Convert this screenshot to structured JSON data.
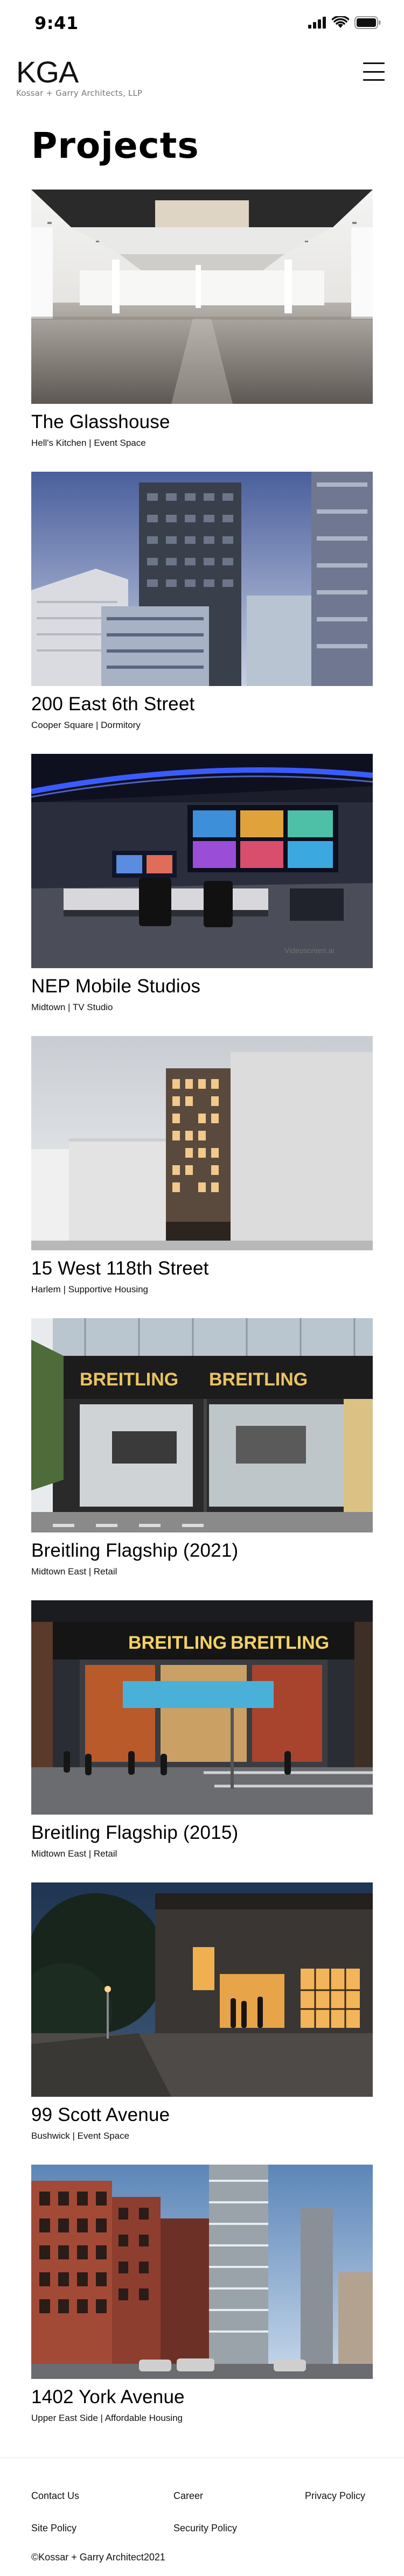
{
  "status_bar": {
    "time": "9:41",
    "icons": [
      "signal-icon",
      "wifi-icon",
      "battery-icon"
    ]
  },
  "header": {
    "logo_mark": "KGA",
    "logo_sub": "Kossar + Garry Architects, LLP",
    "menu_icon": "hamburger-menu-icon"
  },
  "page": {
    "title": "Projects"
  },
  "projects": [
    {
      "name": "The Glasshouse",
      "meta": "Hell's Kitchen | Event Space"
    },
    {
      "name": "200 East 6th Street",
      "meta": "Cooper Square | Dormitory"
    },
    {
      "name": "NEP Mobile Studios",
      "meta": "Midtown | TV Studio"
    },
    {
      "name": "15 West 118th Street",
      "meta": "Harlem | Supportive Housing"
    },
    {
      "name": "Breitling Flagship (2021)",
      "meta": "Midtown East | Retail"
    },
    {
      "name": "Breitling Flagship (2015)",
      "meta": "Midtown East | Retail"
    },
    {
      "name": "99 Scott Avenue",
      "meta": "Bushwick | Event Space"
    },
    {
      "name": "1402 York Avenue",
      "meta": "Upper East Side | Affordable Housing"
    }
  ],
  "images": {
    "breitling_sign": "BREITLING",
    "nep_watermark": "Videoscreen.ai"
  },
  "footer": {
    "contact": "Contact Us",
    "career": "Career",
    "privacy": "Privacy Policy",
    "site": "Site Policy",
    "security": "Security Policy",
    "copyright": "©Kossar + Garry Architect2021"
  }
}
